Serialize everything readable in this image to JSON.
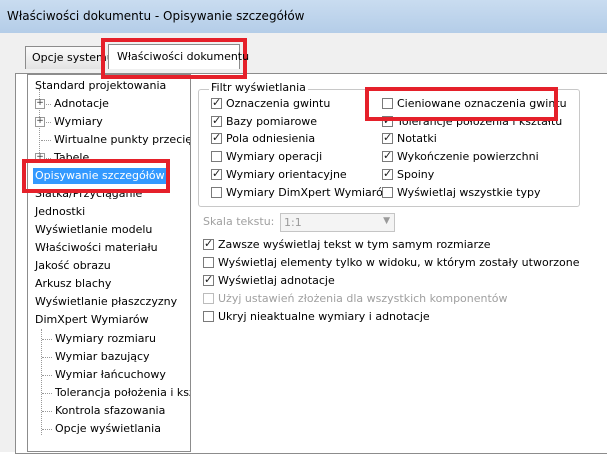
{
  "window": {
    "title": "Właściwości dokumentu - Opisywanie szczegółów"
  },
  "tabs": [
    {
      "label": "Opcje systemu",
      "active": false
    },
    {
      "label": "Właściwości dokumentu",
      "active": true
    }
  ],
  "tree": {
    "items": [
      {
        "label": "Standard projektowania"
      },
      {
        "label": "Adnotacje"
      },
      {
        "label": "Wymiary"
      },
      {
        "label": "Wirtualne punkty przecięcia"
      },
      {
        "label": "Tabele"
      },
      {
        "label": "Opisywanie szczegółów"
      },
      {
        "label": "Siatka/Przyciąganie"
      },
      {
        "label": "Jednostki"
      },
      {
        "label": "Wyświetlanie modelu"
      },
      {
        "label": "Właściwości materiału"
      },
      {
        "label": "Jakość obrazu"
      },
      {
        "label": "Arkusz blachy"
      },
      {
        "label": "Wyświetlanie płaszczyzny"
      },
      {
        "label": "DimXpert Wymiarów"
      },
      {
        "label": "Wymiary rozmiaru"
      },
      {
        "label": "Wymiar bazujący"
      },
      {
        "label": "Wymiar łańcuchowy"
      },
      {
        "label": "Tolerancja położenia i kształtu"
      },
      {
        "label": "Kontrola sfazowania"
      },
      {
        "label": "Opcje wyświetlania"
      }
    ]
  },
  "filter": {
    "legend": "Filtr wyświetlania",
    "left": [
      {
        "label": "Oznaczenia gwintu",
        "checked": true
      },
      {
        "label": "Bazy pomiarowe",
        "checked": true
      },
      {
        "label": "Pola odniesienia",
        "checked": true
      },
      {
        "label": "Wymiary operacji",
        "checked": false
      },
      {
        "label": "Wymiary orientacyjne",
        "checked": true
      },
      {
        "label": "Wymiary DimXpert Wymiarów",
        "checked": false
      }
    ],
    "right": [
      {
        "label": "Cieniowane oznaczenia gwintu",
        "checked": false
      },
      {
        "label": "Tolerancje położenia i kształtu",
        "checked": true
      },
      {
        "label": "Notatki",
        "checked": true
      },
      {
        "label": "Wykończenie powierzchni",
        "checked": true
      },
      {
        "label": "Spoiny",
        "checked": true
      },
      {
        "label": "Wyświetlaj wszystkie typy",
        "checked": false
      }
    ]
  },
  "scale": {
    "label": "Skala tekstu:",
    "value": "1:1"
  },
  "options": [
    {
      "label": "Zawsze wyświetlaj tekst w tym samym rozmiarze",
      "checked": true,
      "disabled": false
    },
    {
      "label": "Wyświetlaj elementy tylko w widoku, w którym zostały utworzone",
      "checked": false,
      "disabled": false
    },
    {
      "label": "Wyświetlaj adnotacje",
      "checked": true,
      "disabled": false
    },
    {
      "label": "Użyj ustawień złożenia dla wszystkich komponentów",
      "checked": false,
      "disabled": true
    },
    {
      "label": "Ukryj nieaktualne wymiary i adnotacje",
      "checked": false,
      "disabled": false
    }
  ],
  "highlight_color": "#e5202a"
}
